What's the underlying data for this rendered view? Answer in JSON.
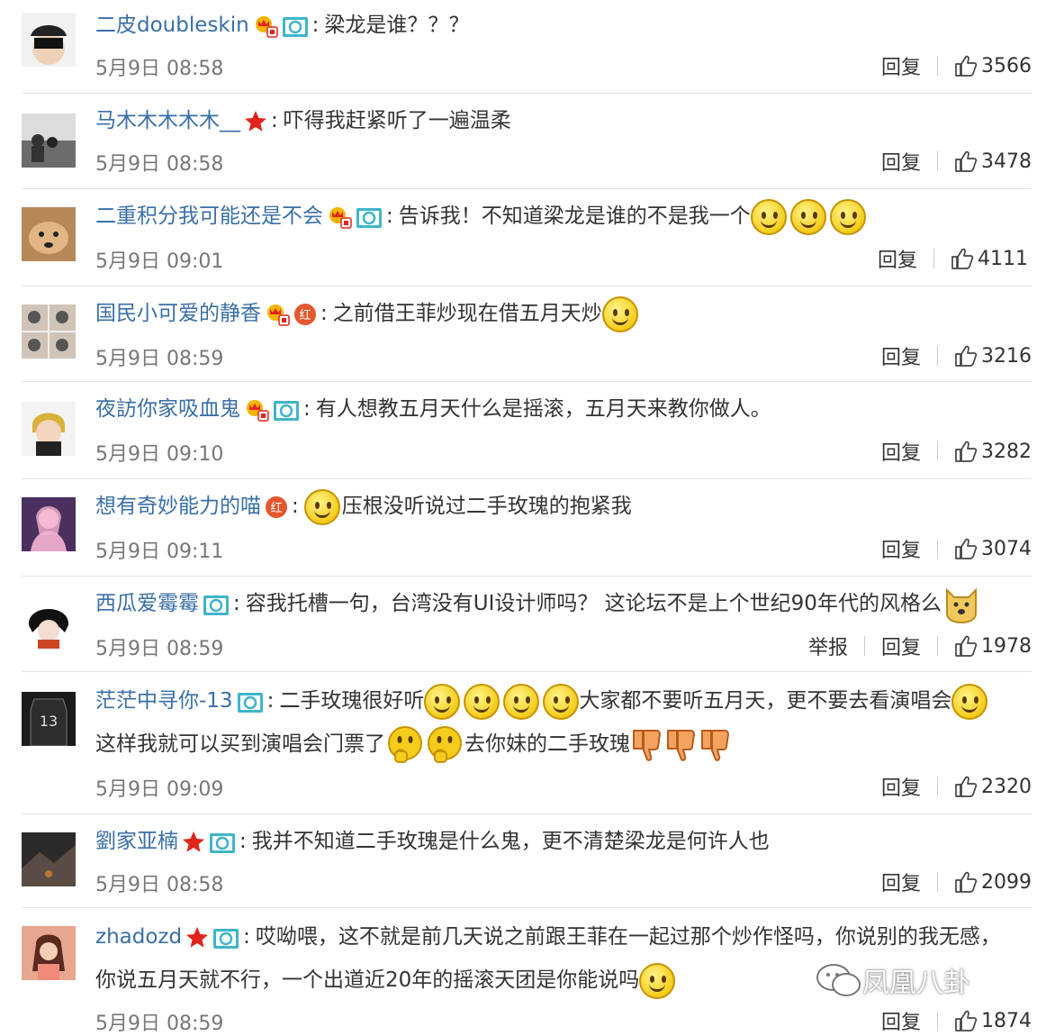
{
  "comments": [
    {
      "name": "二皮doubleskin",
      "text": "梁龙是谁？？？",
      "time": "5月9日 08:58",
      "reply": "回复",
      "likes": "3566"
    },
    {
      "name": "马木木木木木__",
      "text": "吓得我赶紧听了一遍温柔",
      "time": "5月9日 08:58",
      "reply": "回复",
      "likes": "3478"
    },
    {
      "name": "二重积分我可能还是不会",
      "text": "告诉我！不知道梁龙是谁的不是我一个",
      "time": "5月9日 09:01",
      "reply": "回复",
      "likes": "4111"
    },
    {
      "name": "国民小可爱的静香",
      "text": "之前借王菲炒现在借五月天炒",
      "time": "5月9日 08:59",
      "reply": "回复",
      "likes": "3216"
    },
    {
      "name": "夜訪你家吸血鬼",
      "text": "有人想教五月天什么是摇滚，五月天来教你做人。",
      "time": "5月9日 09:10",
      "reply": "回复",
      "likes": "3282"
    },
    {
      "name": "想有奇妙能力的喵",
      "text": "压根没听说过二手玫瑰的抱紧我",
      "time": "5月9日 09:11",
      "reply": "回复",
      "likes": "3074"
    },
    {
      "name": "西瓜爱霉霉",
      "text": "容我托槽一句，台湾没有UI设计师吗？ 这论坛不是上个世纪90年代的风格么",
      "time": "5月9日 08:59",
      "report": "举报",
      "reply": "回复",
      "likes": "1978"
    },
    {
      "name": "茫茫中寻你-13",
      "text_a": "二手玫瑰很好听",
      "text_b": "大家都不要听五月天，更不要去看演唱会",
      "text_c": "这样我就可以买到演唱会门票了",
      "text_d": "去你妹的二手玫瑰",
      "time": "5月9日 09:09",
      "reply": "回复",
      "likes": "2320"
    },
    {
      "name": "劉家亚楠",
      "text": "我并不知道二手玫瑰是什么鬼，更不清楚梁龙是何许人也",
      "time": "5月9日 08:58",
      "reply": "回复",
      "likes": "2099"
    },
    {
      "name": "zhadozd",
      "text": "哎呦喂，这不就是前几天说之前跟王菲在一起过那个炒作怪吗，你说别的我无感，你说五月天就不行，一个出道近20年的摇滚天团是你能说吗",
      "time": "5月9日 08:59",
      "reply": "回复",
      "likes": "1874"
    }
  ],
  "watermark": "凤凰八卦",
  "colors": {
    "name": "#3a6fa8",
    "divider": "#e2e2e2",
    "meta": "#777777"
  }
}
